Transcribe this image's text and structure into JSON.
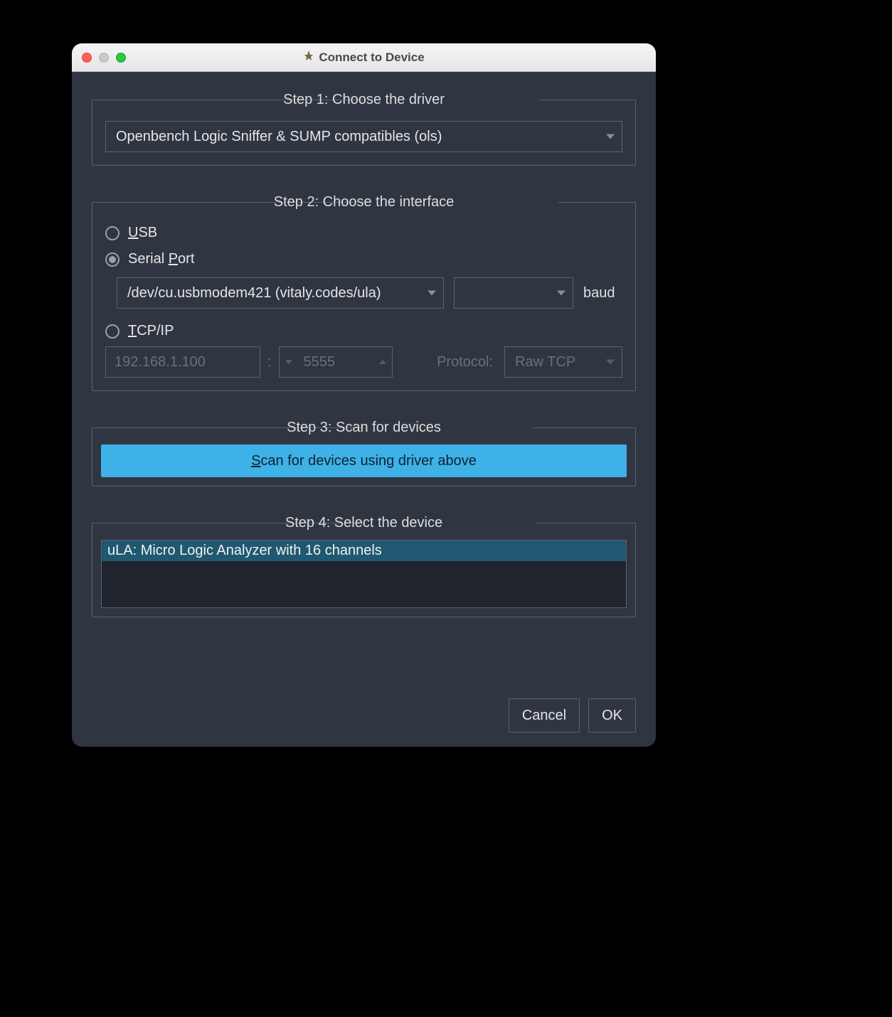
{
  "window": {
    "title": "Connect to Device"
  },
  "step1": {
    "legend": "Step 1: Choose the driver",
    "driver": "Openbench Logic Sniffer & SUMP compatibles (ols)"
  },
  "step2": {
    "legend": "Step 2: Choose the interface",
    "usb_label_pre": "U",
    "usb_label_post": "SB",
    "serial_label_pre": "Serial ",
    "serial_label_m": "P",
    "serial_label_post": "ort",
    "serial_port": "/dev/cu.usbmodem421 (vitaly.codes/ula)",
    "baud_value": "",
    "baud_label": "baud",
    "tcp_label_m": "T",
    "tcp_label_post": "CP/IP",
    "ip_placeholder": "192.168.1.100",
    "port_placeholder": "5555",
    "protocol_label": "Protocol:",
    "protocol_value": "Raw TCP",
    "selected": "serial"
  },
  "step3": {
    "legend": "Step 3: Scan for devices",
    "button_m": "S",
    "button_rest": "can for devices using driver above"
  },
  "step4": {
    "legend": "Step 4: Select the device",
    "devices": [
      "uLA: Micro Logic Analyzer with 16 channels"
    ]
  },
  "footer": {
    "cancel": "Cancel",
    "ok": "OK"
  }
}
